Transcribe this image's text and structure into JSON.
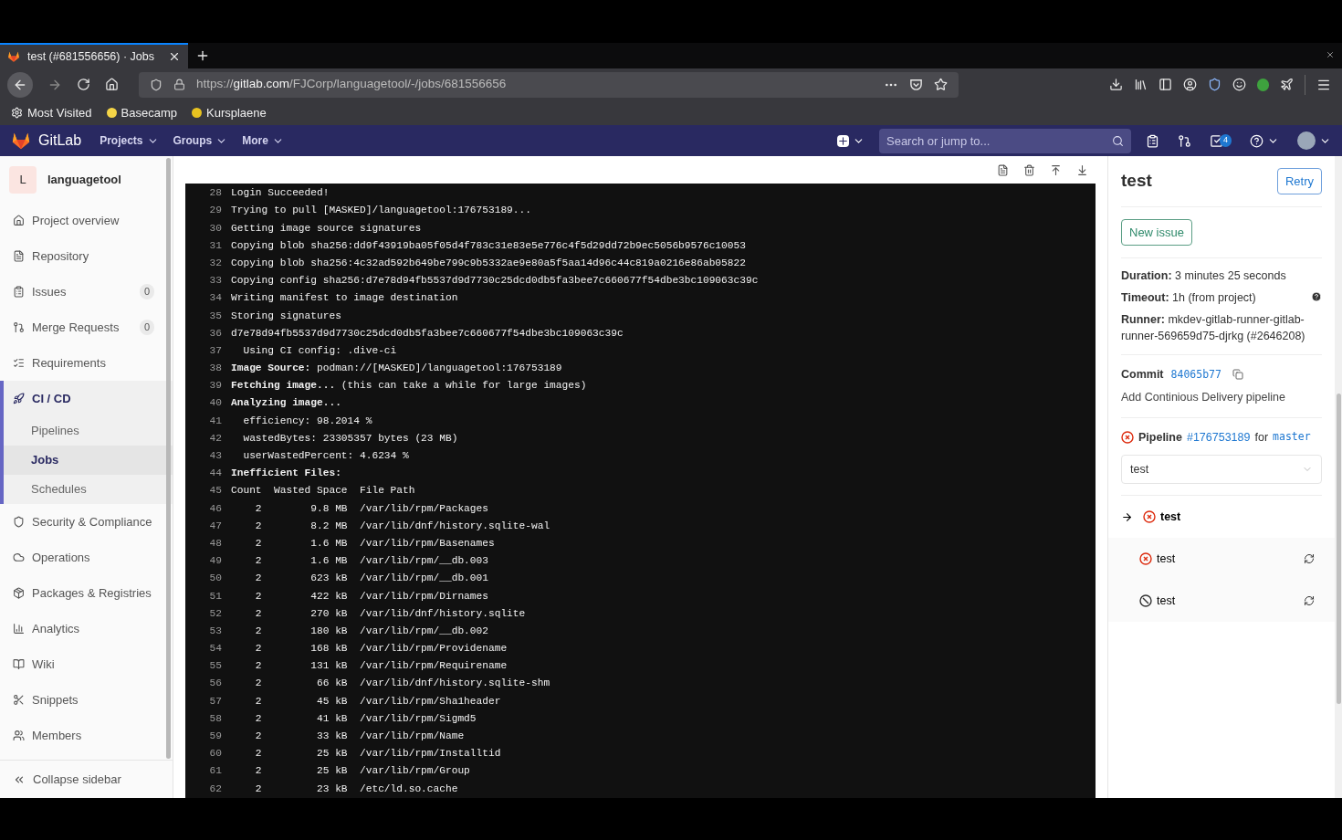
{
  "browser": {
    "tabs": [
      {
        "title": "test (#681556656) · Jobs",
        "selected": true
      }
    ],
    "url": {
      "host": "gitlab.com",
      "path": "/FJCorp/languagetool/-/jobs/681556656",
      "scheme": "https://"
    },
    "bookmarks": [
      "Most Visited",
      "Basecamp",
      "Kursplaene"
    ]
  },
  "header": {
    "brand": "GitLab",
    "menus": [
      "Projects",
      "Groups",
      "More"
    ],
    "search": {
      "placeholder": "Search or jump to..."
    },
    "todo_count": "4"
  },
  "sidebar": {
    "project": {
      "avatar": "L",
      "name": "languagetool"
    },
    "items": [
      {
        "label": "Project overview",
        "selected": false
      },
      {
        "label": "Repository",
        "selected": false
      },
      {
        "label": "Issues",
        "count": "0",
        "selected": false
      },
      {
        "label": "Merge Requests",
        "count": "0",
        "selected": false
      },
      {
        "label": "Requirements",
        "selected": false
      },
      {
        "label": "CI / CD",
        "selected": true,
        "children": [
          {
            "label": "Pipelines",
            "selected": false
          },
          {
            "label": "Jobs",
            "selected": true
          },
          {
            "label": "Schedules",
            "selected": false
          }
        ]
      },
      {
        "label": "Security & Compliance",
        "selected": false
      },
      {
        "label": "Operations",
        "selected": false
      },
      {
        "label": "Packages & Registries",
        "selected": false
      },
      {
        "label": "Analytics",
        "selected": false
      },
      {
        "label": "Wiki",
        "selected": false
      },
      {
        "label": "Snippets",
        "selected": false
      },
      {
        "label": "Members",
        "selected": false
      }
    ],
    "collapse": "Collapse sidebar"
  },
  "log": {
    "lines": [
      {
        "n": "28",
        "text": "Login Succeeded!"
      },
      {
        "n": "29",
        "text": "Trying to pull [MASKED]/languagetool:176753189..."
      },
      {
        "n": "30",
        "text": "Getting image source signatures"
      },
      {
        "n": "31",
        "text": "Copying blob sha256:dd9f43919ba05f05d4f783c31e83e5e776c4f5d29dd72b9ec5056b9576c10053"
      },
      {
        "n": "32",
        "text": "Copying blob sha256:4c32ad592b649be799c9b5332ae9e80a5f5aa14d96c44c819a0216e86ab05822"
      },
      {
        "n": "33",
        "text": "Copying config sha256:d7e78d94fb5537d9d7730c25dcd0db5fa3bee7c660677f54dbe3bc109063c39c"
      },
      {
        "n": "34",
        "text": "Writing manifest to image destination"
      },
      {
        "n": "35",
        "text": "Storing signatures"
      },
      {
        "n": "36",
        "text": "d7e78d94fb5537d9d7730c25dcd0db5fa3bee7c660677f54dbe3bc109063c39c"
      },
      {
        "n": "37",
        "text": "  Using CI config: .dive-ci"
      },
      {
        "n": "38",
        "text": "**Image Source:** podman://[MASKED]/languagetool:176753189"
      },
      {
        "n": "39",
        "text": "**Fetching image...** (this can take a while for large images)"
      },
      {
        "n": "40",
        "text": "**Analyzing image...**"
      },
      {
        "n": "41",
        "text": "  efficiency: 98.2014 %"
      },
      {
        "n": "42",
        "text": "  wastedBytes: 23305357 bytes (23 MB)"
      },
      {
        "n": "43",
        "text": "  userWastedPercent: 4.6234 %"
      },
      {
        "n": "44",
        "text": "**Inefficient Files:**"
      },
      {
        "n": "45",
        "text": "Count  Wasted Space  File Path"
      },
      {
        "n": "46",
        "text": "    2        9.8 MB  /var/lib/rpm/Packages"
      },
      {
        "n": "47",
        "text": "    2        8.2 MB  /var/lib/dnf/history.sqlite-wal"
      },
      {
        "n": "48",
        "text": "    2        1.6 MB  /var/lib/rpm/Basenames"
      },
      {
        "n": "49",
        "text": "    2        1.6 MB  /var/lib/rpm/__db.003"
      },
      {
        "n": "50",
        "text": "    2        623 kB  /var/lib/rpm/__db.001"
      },
      {
        "n": "51",
        "text": "    2        422 kB  /var/lib/rpm/Dirnames"
      },
      {
        "n": "52",
        "text": "    2        270 kB  /var/lib/dnf/history.sqlite"
      },
      {
        "n": "53",
        "text": "    2        180 kB  /var/lib/rpm/__db.002"
      },
      {
        "n": "54",
        "text": "    2        168 kB  /var/lib/rpm/Providename"
      },
      {
        "n": "55",
        "text": "    2        131 kB  /var/lib/rpm/Requirename"
      },
      {
        "n": "56",
        "text": "    2         66 kB  /var/lib/dnf/history.sqlite-shm"
      },
      {
        "n": "57",
        "text": "    2         45 kB  /var/lib/rpm/Sha1header"
      },
      {
        "n": "58",
        "text": "    2         41 kB  /var/lib/rpm/Sigmd5"
      },
      {
        "n": "59",
        "text": "    2         33 kB  /var/lib/rpm/Name"
      },
      {
        "n": "60",
        "text": "    2         25 kB  /var/lib/rpm/Installtid"
      },
      {
        "n": "61",
        "text": "    2         25 kB  /var/lib/rpm/Group"
      },
      {
        "n": "62",
        "text": "    2         23 kB  /etc/ld.so.cache"
      }
    ]
  },
  "job": {
    "title": "test",
    "retry": "Retry",
    "new_issue": "New issue",
    "details": [
      {
        "label": "Duration:",
        "value": "3 minutes 25 seconds"
      },
      {
        "label": "Timeout:",
        "value": "1h (from project)",
        "help": true
      },
      {
        "label": "Runner:",
        "value": "mkdev-gitlab-runner-gitlab-runner-569659d75-djrkg (#2646208)"
      }
    ],
    "commit": {
      "label": "Commit",
      "sha": "84065b77",
      "message": "Add Continious Delivery pipeline"
    },
    "pipeline": {
      "kind": "failed",
      "label": "Pipeline",
      "id": "#176753189",
      "for": "for",
      "branch": "master"
    },
    "stage": "test",
    "jobs": [
      {
        "name": "test",
        "kind": "failed",
        "current": true,
        "retry": false
      },
      {
        "name": "test",
        "kind": "failed",
        "current": false,
        "retry": true
      },
      {
        "name": "test",
        "kind": "canceled",
        "current": false,
        "retry": true
      }
    ]
  }
}
